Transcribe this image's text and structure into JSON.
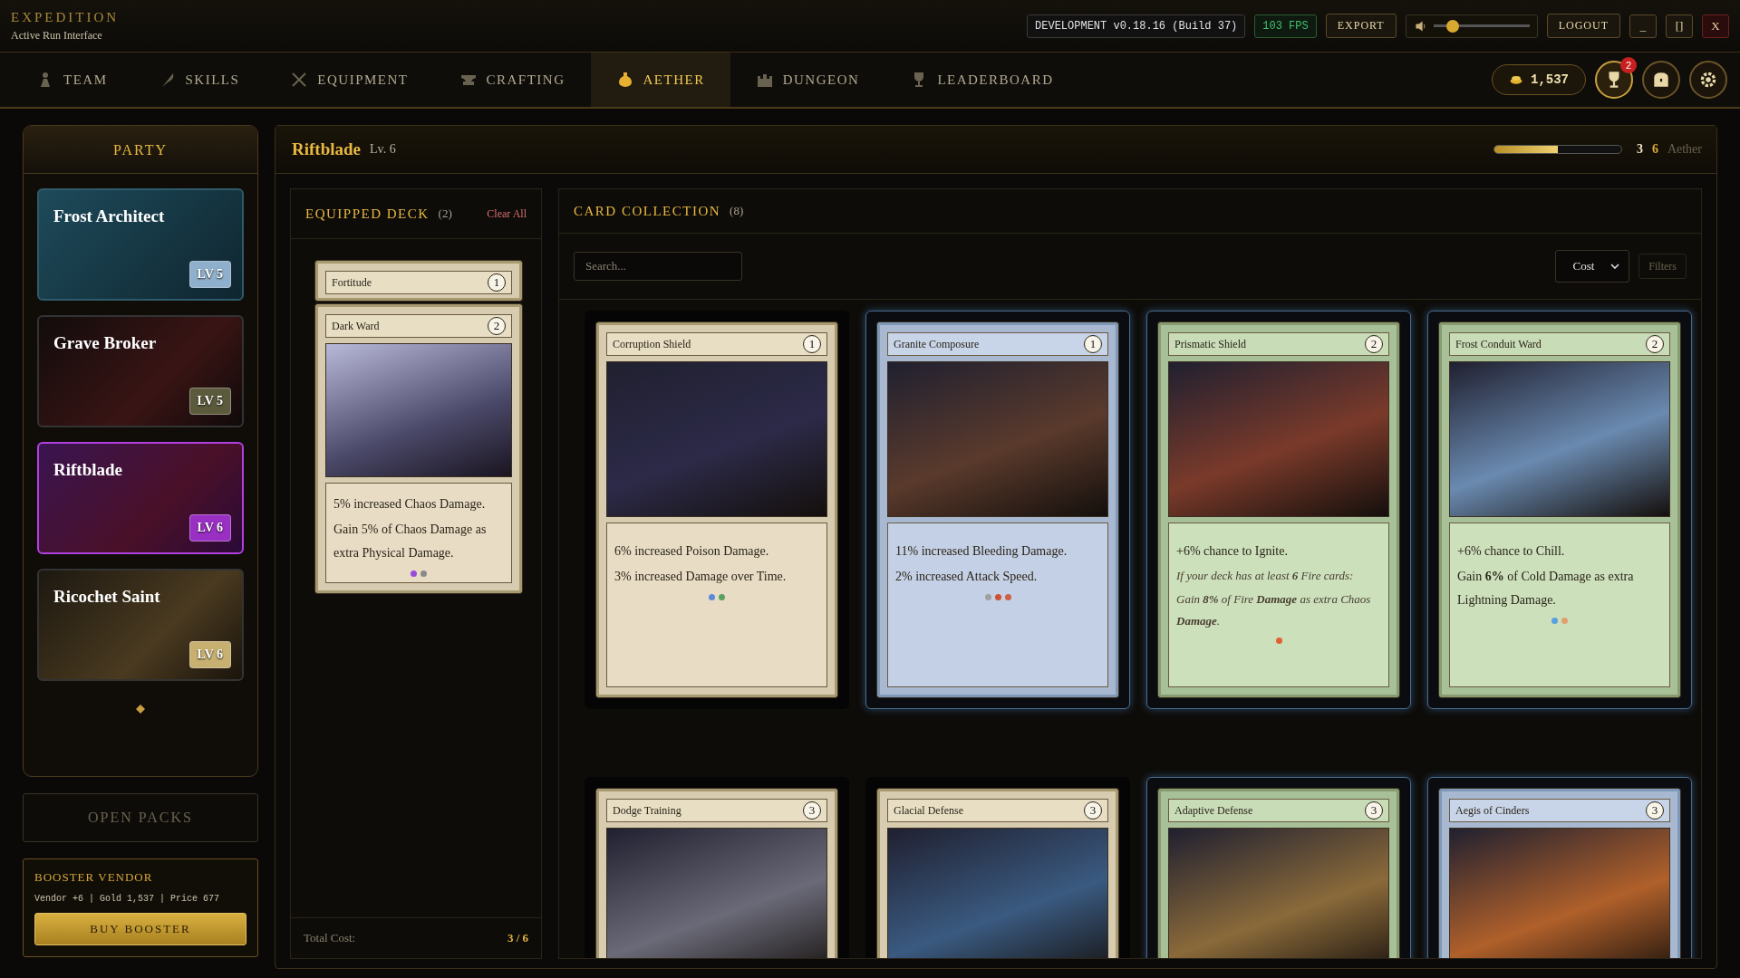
{
  "app": {
    "title": "EXPEDITION",
    "subtitle": "Active Run Interface"
  },
  "topbar": {
    "version": "DEVELOPMENT v0.18.16 (Build 37)",
    "fps": "103 FPS",
    "export": "EXPORT",
    "volume": {
      "level": 0.2
    },
    "logout": "LOGOUT",
    "window_buttons": [
      "_",
      "[]",
      "X"
    ]
  },
  "nav": [
    {
      "label": "TEAM",
      "selected": false
    },
    {
      "label": "SKILLS",
      "selected": false
    },
    {
      "label": "EQUIPMENT",
      "selected": false
    },
    {
      "label": "CRAFTING",
      "selected": false
    },
    {
      "label": "AETHER",
      "selected": true
    },
    {
      "label": "DUNGEON",
      "selected": false
    },
    {
      "label": "LEADERBOARD",
      "selected": false
    }
  ],
  "gold": "1,537",
  "notifications": "2",
  "party": {
    "title": "PARTY",
    "members": [
      {
        "name": "Frost Architect",
        "level": "LV 5",
        "color": "#8fb0cc",
        "selected": false
      },
      {
        "name": "Grave Broker",
        "level": "LV 5",
        "color": "#5c5a3c",
        "selected": false
      },
      {
        "name": "Riftblade",
        "level": "LV 6",
        "color": "#9a2fc4",
        "selected": true
      },
      {
        "name": "Ricochet Saint",
        "level": "LV 6",
        "color": "#c8b070",
        "selected": false
      }
    ]
  },
  "open_packs": "OPEN PACKS",
  "vendor": {
    "title": "BOOSTER VENDOR",
    "info": "Vendor +6 | Gold 1,537 | Price 677",
    "button": "BUY BOOSTER"
  },
  "hero": {
    "name": "Riftblade",
    "level": "Lv. 6",
    "aether": {
      "level": 0.5,
      "current": "3",
      "max": "6",
      "label": "Aether"
    }
  },
  "deck": {
    "title": "EQUIPPED DECK",
    "count": "(2)",
    "clear": "Clear All",
    "total_label": "Total Cost:",
    "total": "3 / 6",
    "cards": [
      {
        "name": "Fortitude",
        "cost": "1",
        "kind": "parchment"
      },
      {
        "name": "Dark Ward",
        "cost": "2",
        "kind": "parchment",
        "lines": [
          {
            "text": "5% increased Chaos Damage.",
            "italic": false
          },
          {
            "text": "Gain 5% of Chaos Damage as extra Physical Damage.",
            "italic": false
          }
        ],
        "gems": [
          {
            "color": "#9a4ad8"
          },
          {
            "color": "#8a8a8a"
          }
        ]
      }
    ]
  },
  "collection": {
    "title": "CARD COLLECTION",
    "count": "(8)",
    "search": {
      "placeholder": "Search..."
    },
    "sort": "Cost",
    "filters": "Filters",
    "cards": [
      {
        "name": "Corruption Shield",
        "cost": "1",
        "kind": "parchment",
        "highlighted": false,
        "lines": [
          {
            "text": "6% increased Poison Damage.",
            "italic": false
          },
          {
            "text": "3% increased Damage over Time.",
            "italic": false
          }
        ],
        "gems": [
          {
            "color": "#5a8ad8"
          },
          {
            "color": "#5aa060"
          }
        ]
      },
      {
        "name": "Granite Composure",
        "cost": "1",
        "kind": "ice",
        "highlighted": true,
        "lines": [
          {
            "text": "11% increased Bleeding Damage.",
            "italic": false
          },
          {
            "text": "2% increased Attack Speed.",
            "italic": false
          }
        ],
        "gems": [
          {
            "color": "#a0a0a0"
          },
          {
            "color": "#d05030"
          },
          {
            "color": "#d06040"
          }
        ]
      },
      {
        "name": "Prismatic Shield",
        "cost": "2",
        "kind": "jade",
        "highlighted": true,
        "lines": [
          {
            "text": "+6% chance to Ignite.",
            "italic": false
          },
          {
            "text": "If your deck has at least **6** Fire cards:",
            "italic": true
          },
          {
            "text": "Gain **8%** of Fire **Damage** as extra Chaos **Damage**.",
            "italic": true
          }
        ],
        "gems": [
          {
            "color": "#e06030"
          }
        ]
      },
      {
        "name": "Frost Conduit Ward",
        "cost": "2",
        "kind": "jade",
        "highlighted": true,
        "lines": [
          {
            "text": "+6% chance to Chill.",
            "italic": false
          },
          {
            "text": "Gain **6%** of Cold Damage as extra Lightning Damage.",
            "italic": false
          }
        ],
        "gems": [
          {
            "color": "#5aa0e0"
          },
          {
            "color": "#e0a070"
          }
        ]
      },
      {
        "name": "Dodge Training",
        "cost": "3",
        "kind": "parchment",
        "highlighted": false
      },
      {
        "name": "Glacial Defense",
        "cost": "3",
        "kind": "parchment",
        "highlighted": false
      },
      {
        "name": "Adaptive Defense",
        "cost": "3",
        "kind": "jade",
        "highlighted": true
      },
      {
        "name": "Aegis of Cinders",
        "cost": "3",
        "kind": "ice",
        "highlighted": true
      }
    ]
  }
}
